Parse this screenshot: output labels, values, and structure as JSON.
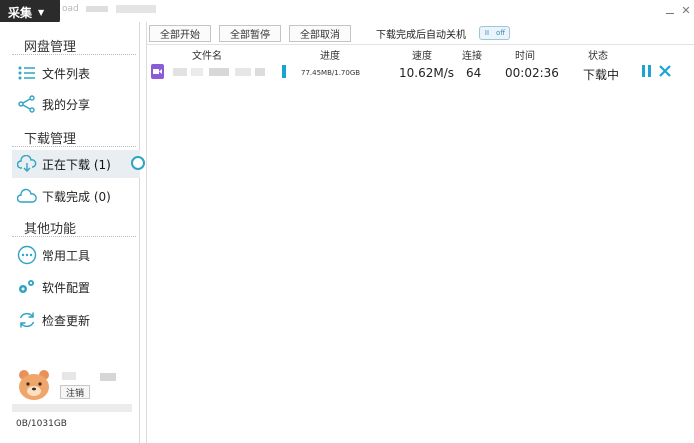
{
  "titlebar": {
    "menu_label": "采集",
    "title_text": "oad"
  },
  "sidebar": {
    "sections": [
      {
        "title": "网盘管理"
      },
      {
        "title": "下载管理"
      },
      {
        "title": "其他功能"
      }
    ],
    "items": [
      {
        "label": "文件列表",
        "icon": "list-icon"
      },
      {
        "label": "我的分享",
        "icon": "share-icon"
      },
      {
        "label": "正在下载 (1)",
        "icon": "cloud-download-icon"
      },
      {
        "label": "下载完成 (0)",
        "icon": "cloud-done-icon"
      },
      {
        "label": "常用工具",
        "icon": "more-icon"
      },
      {
        "label": "软件配置",
        "icon": "gear-icon"
      },
      {
        "label": "检查更新",
        "icon": "refresh-icon"
      }
    ],
    "user": {
      "logout_label": "注销",
      "quota": "0B/1031GB"
    }
  },
  "toolbar": {
    "start_all": "全部开始",
    "pause_all": "全部暂停",
    "cancel_all": "全部取消",
    "auto_shutdown_label": "下载完成后自动关机",
    "toggle_on_glyph": "II",
    "toggle_off_label": "off"
  },
  "table": {
    "columns": [
      "文件名",
      "进度",
      "速度",
      "连接",
      "时间",
      "状态"
    ],
    "rows": [
      {
        "progress": "77.45MB/1.70GB",
        "speed": "10.62M/s",
        "connections": "64",
        "time": "00:02:36",
        "status": "下载中"
      }
    ]
  },
  "colors": {
    "accent": "#1ba4d3",
    "file_icon": "#8b5cd6",
    "menu_bg": "#2b2b2b"
  }
}
